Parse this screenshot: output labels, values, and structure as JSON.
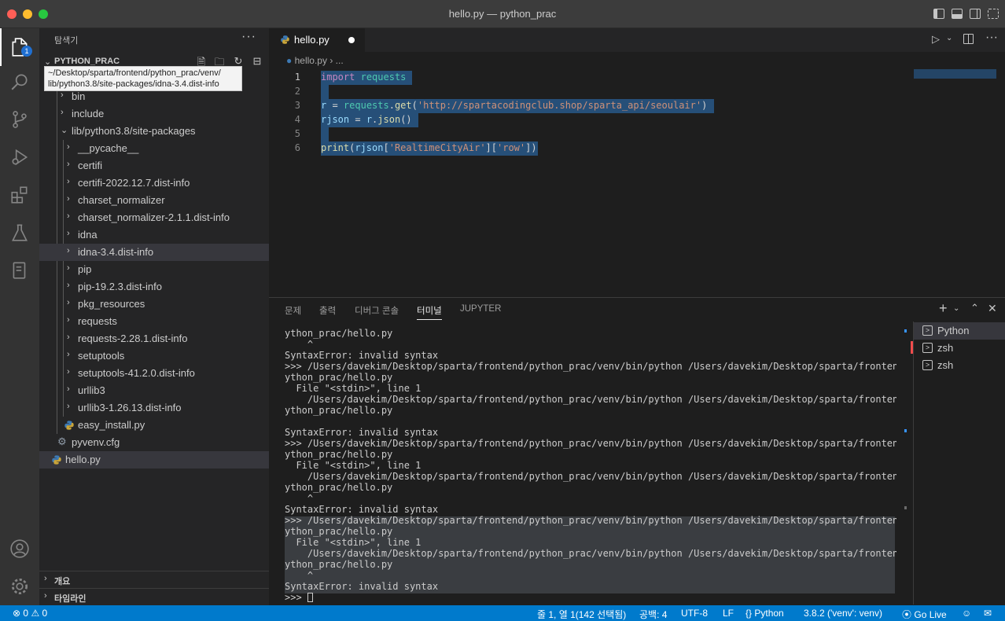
{
  "window": {
    "title": "hello.py — python_prac"
  },
  "activity": {
    "explorer_badge": "1"
  },
  "sidebar": {
    "header": "탐색기",
    "more": "···",
    "project": "PYTHON_PRAC",
    "tooltip_line1": "~/Desktop/sparta/frontend/python_prac/venv/",
    "tooltip_line2": "lib/python3.8/site-packages/idna-3.4.dist-info",
    "tree": [
      {
        "label": "bin",
        "type": "folder"
      },
      {
        "label": "include",
        "type": "folder"
      },
      {
        "label": "lib/python3.8/site-packages",
        "type": "folder-open"
      },
      {
        "label": "__pycache__",
        "type": "folder"
      },
      {
        "label": "certifi",
        "type": "folder"
      },
      {
        "label": "certifi-2022.12.7.dist-info",
        "type": "folder"
      },
      {
        "label": "charset_normalizer",
        "type": "folder"
      },
      {
        "label": "charset_normalizer-2.1.1.dist-info",
        "type": "folder"
      },
      {
        "label": "idna",
        "type": "folder"
      },
      {
        "label": "idna-3.4.dist-info",
        "type": "folder"
      },
      {
        "label": "pip",
        "type": "folder"
      },
      {
        "label": "pip-19.2.3.dist-info",
        "type": "folder"
      },
      {
        "label": "pkg_resources",
        "type": "folder"
      },
      {
        "label": "requests",
        "type": "folder"
      },
      {
        "label": "requests-2.28.1.dist-info",
        "type": "folder"
      },
      {
        "label": "setuptools",
        "type": "folder"
      },
      {
        "label": "setuptools-41.2.0.dist-info",
        "type": "folder"
      },
      {
        "label": "urllib3",
        "type": "folder"
      },
      {
        "label": "urllib3-1.26.13.dist-info",
        "type": "folder"
      },
      {
        "label": "easy_install.py",
        "type": "python"
      },
      {
        "label": "pyvenv.cfg",
        "type": "gear"
      },
      {
        "label": "hello.py",
        "type": "python"
      }
    ],
    "outline": "개요",
    "timeline": "타임라인"
  },
  "editor": {
    "tab_label": "hello.py",
    "breadcrumb_file": "hello.py",
    "breadcrumb_more": "...",
    "line_numbers": [
      "1",
      "2",
      "3",
      "4",
      "5",
      "6"
    ]
  },
  "panel": {
    "tabs": [
      "문제",
      "출력",
      "디버그 콘솔",
      "터미널",
      "JUPYTER"
    ],
    "active_tab": "터미널",
    "terminal_lines": [
      "ython_prac/hello.py",
      "    ^",
      "SyntaxError: invalid syntax",
      ">>> /Users/davekim/Desktop/sparta/frontend/python_prac/venv/bin/python /Users/davekim/Desktop/sparta/frontend/p",
      "ython_prac/hello.py",
      "  File \"<stdin>\", line 1",
      "    /Users/davekim/Desktop/sparta/frontend/python_prac/venv/bin/python /Users/davekim/Desktop/sparta/frontend/p",
      "ython_prac/hello.py",
      "",
      "SyntaxError: invalid syntax",
      ">>> /Users/davekim/Desktop/sparta/frontend/python_prac/venv/bin/python /Users/davekim/Desktop/sparta/frontend/p",
      "ython_prac/hello.py",
      "  File \"<stdin>\", line 1",
      "    /Users/davekim/Desktop/sparta/frontend/python_prac/venv/bin/python /Users/davekim/Desktop/sparta/frontend/p",
      "ython_prac/hello.py",
      "    ^",
      "SyntaxError: invalid syntax",
      ">>> /Users/davekim/Desktop/sparta/frontend/python_prac/venv/bin/python /Users/davekim/Desktop/sparta/frontend/p",
      "ython_prac/hello.py",
      "  File \"<stdin>\", line 1",
      "    /Users/davekim/Desktop/sparta/frontend/python_prac/venv/bin/python /Users/davekim/Desktop/sparta/frontend/p",
      "ython_prac/hello.py",
      "    ^",
      "SyntaxError: invalid syntax"
    ],
    "prompt": ">>> ",
    "terminals": [
      "Python",
      "zsh",
      "zsh"
    ]
  },
  "status": {
    "errors": "0",
    "warnings": "0",
    "position": "줄 1, 열 1(142 선택됨)",
    "spaces": "공백: 4",
    "encoding": "UTF-8",
    "eol": "LF",
    "language": "Python",
    "interpreter": "3.8.2 ('venv': venv)",
    "golive": "Go Live"
  }
}
